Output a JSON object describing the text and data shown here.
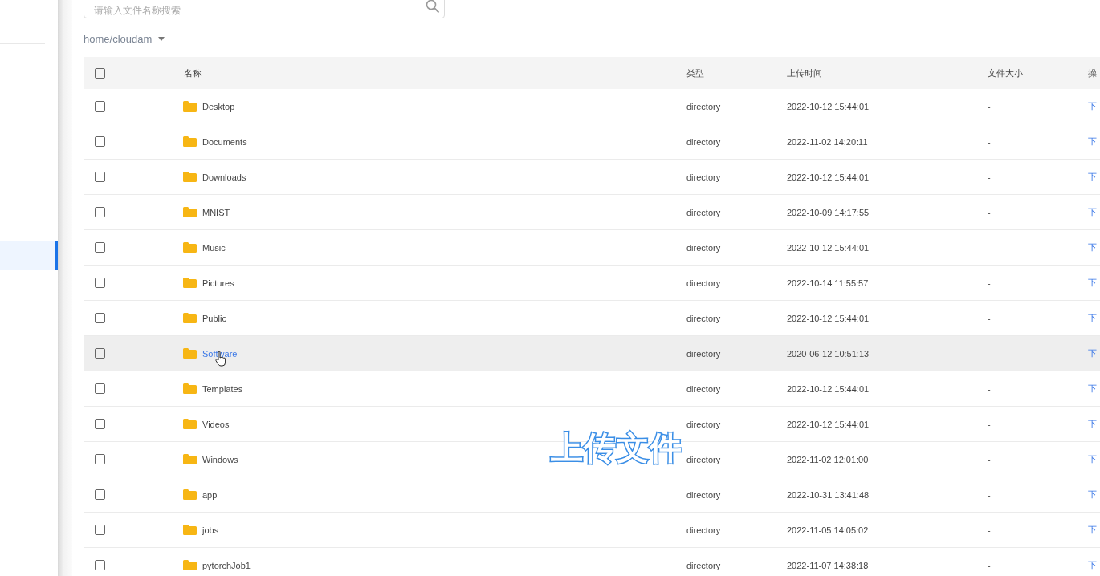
{
  "search": {
    "placeholder": "请输入文件名称搜索"
  },
  "path": {
    "label": "home/cloudam"
  },
  "table": {
    "columns": [
      "名称",
      "类型",
      "上传时间",
      "文件大小",
      "操"
    ],
    "all_checked": false,
    "rows": [
      {
        "name": "Desktop",
        "type": "directory",
        "time": "2022-10-12 15:44:01",
        "size": "-",
        "action": "下",
        "checked": false,
        "hovered": false
      },
      {
        "name": "Documents",
        "type": "directory",
        "time": "2022-11-02 14:20:11",
        "size": "-",
        "action": "下",
        "checked": false,
        "hovered": false
      },
      {
        "name": "Downloads",
        "type": "directory",
        "time": "2022-10-12 15:44:01",
        "size": "-",
        "action": "下",
        "checked": false,
        "hovered": false
      },
      {
        "name": "MNIST",
        "type": "directory",
        "time": "2022-10-09 14:17:55",
        "size": "-",
        "action": "下",
        "checked": false,
        "hovered": false
      },
      {
        "name": "Music",
        "type": "directory",
        "time": "2022-10-12 15:44:01",
        "size": "-",
        "action": "下",
        "checked": false,
        "hovered": false
      },
      {
        "name": "Pictures",
        "type": "directory",
        "time": "2022-10-14 11:55:57",
        "size": "-",
        "action": "下",
        "checked": false,
        "hovered": false
      },
      {
        "name": "Public",
        "type": "directory",
        "time": "2022-10-12 15:44:01",
        "size": "-",
        "action": "下",
        "checked": false,
        "hovered": false
      },
      {
        "name": "Software",
        "type": "directory",
        "time": "2020-06-12 10:51:13",
        "size": "-",
        "action": "下",
        "checked": false,
        "hovered": true
      },
      {
        "name": "Templates",
        "type": "directory",
        "time": "2022-10-12 15:44:01",
        "size": "-",
        "action": "下",
        "checked": false,
        "hovered": false
      },
      {
        "name": "Videos",
        "type": "directory",
        "time": "2022-10-12 15:44:01",
        "size": "-",
        "action": "下",
        "checked": false,
        "hovered": false
      },
      {
        "name": "Windows",
        "type": "directory",
        "time": "2022-11-02 12:01:00",
        "size": "-",
        "action": "下",
        "checked": false,
        "hovered": false
      },
      {
        "name": "app",
        "type": "directory",
        "time": "2022-10-31 13:41:48",
        "size": "-",
        "action": "下",
        "checked": false,
        "hovered": false
      },
      {
        "name": "jobs",
        "type": "directory",
        "time": "2022-11-05 14:05:02",
        "size": "-",
        "action": "下",
        "checked": false,
        "hovered": false
      },
      {
        "name": "pytorchJob1",
        "type": "directory",
        "time": "2022-11-07 14:38:18",
        "size": "-",
        "action": "下",
        "checked": false,
        "hovered": false
      }
    ]
  },
  "caption": {
    "text": "上传文件"
  }
}
